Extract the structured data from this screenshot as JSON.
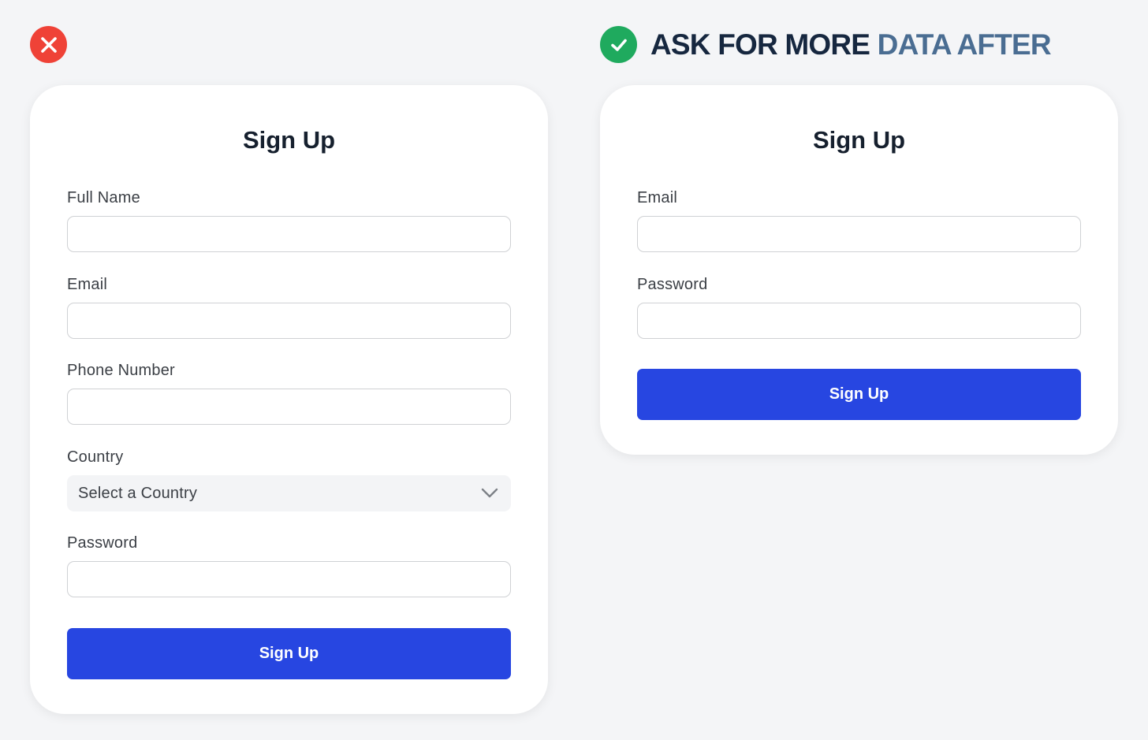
{
  "comparison": {
    "bad": {
      "icon": "x-mark-icon",
      "color": "#ef4237"
    },
    "good": {
      "icon": "checkmark-icon",
      "color": "#1faa5e",
      "headline_part1": "ASK FOR MORE ",
      "headline_part2": "DATA AFTER"
    }
  },
  "long_form": {
    "title": "Sign Up",
    "fields": [
      {
        "label": "Full Name",
        "value": ""
      },
      {
        "label": "Email",
        "value": ""
      },
      {
        "label": "Phone Number",
        "value": ""
      },
      {
        "label": "Country",
        "selected": "Select a Country"
      },
      {
        "label": "Password",
        "value": ""
      }
    ],
    "submit_label": "Sign Up"
  },
  "short_form": {
    "title": "Sign Up",
    "fields": [
      {
        "label": "Email",
        "value": ""
      },
      {
        "label": "Password",
        "value": ""
      }
    ],
    "submit_label": "Sign Up"
  },
  "colors": {
    "background": "#f4f5f7",
    "card": "#ffffff",
    "primary_button": "#2746e1",
    "headline_dark": "#16273f",
    "headline_accent": "#4a6d92"
  }
}
